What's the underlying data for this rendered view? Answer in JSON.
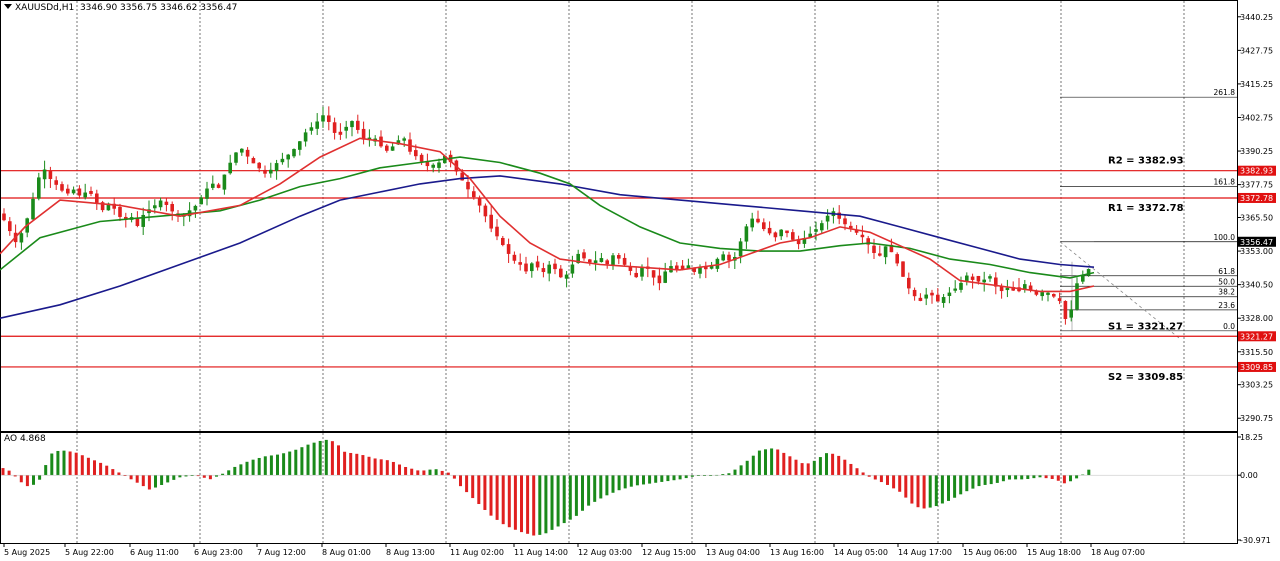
{
  "header": {
    "symbol_timeframe": "XAUUSDd,H1",
    "ohlc": "3346.90 3356.75 3346.62 3356.47"
  },
  "indicator": {
    "label": "AO 4.868"
  },
  "colors": {
    "bull": "#1a8a1a",
    "bear": "#e02020",
    "ma_fast": "#e03030",
    "ma_mid": "#1a8a1a",
    "ma_slow": "#1a1a8c",
    "level_line": "#e01010",
    "price_tag": "#000000"
  },
  "current_price": "3356.47",
  "chart_data": {
    "type": "candlestick",
    "symbol": "XAUUSDd",
    "timeframe": "H1",
    "ylim": [
      3290,
      3445
    ],
    "price_axis_ticks": [
      "3440.25",
      "3427.75",
      "3415.25",
      "3402.75",
      "3390.25",
      "3377.75",
      "3365.50",
      "3353.00",
      "3340.50",
      "3328.00",
      "3315.50",
      "3303.25",
      "3290.75"
    ],
    "time_labels": [
      "5 Aug 2025",
      "5 Aug 22:00",
      "6 Aug 11:00",
      "6 Aug 23:00",
      "7 Aug 12:00",
      "8 Aug 01:00",
      "8 Aug 13:00",
      "11 Aug 02:00",
      "11 Aug 14:00",
      "12 Aug 03:00",
      "12 Aug 15:00",
      "13 Aug 04:00",
      "13 Aug 16:00",
      "14 Aug 05:00",
      "14 Aug 17:00",
      "15 Aug 06:00",
      "15 Aug 18:00",
      "18 Aug 07:00"
    ],
    "close_path": [
      [
        0,
        3367
      ],
      [
        8,
        3362
      ],
      [
        15,
        3356
      ],
      [
        22,
        3360
      ],
      [
        28,
        3366
      ],
      [
        35,
        3375
      ],
      [
        42,
        3385
      ],
      [
        50,
        3380
      ],
      [
        58,
        3377
      ],
      [
        66,
        3374
      ],
      [
        74,
        3376
      ],
      [
        81,
        3373
      ],
      [
        88,
        3376
      ],
      [
        95,
        3372
      ],
      [
        102,
        3368
      ],
      [
        109,
        3371
      ],
      [
        116,
        3368
      ],
      [
        123,
        3364
      ],
      [
        131,
        3366
      ],
      [
        138,
        3362
      ],
      [
        145,
        3368
      ],
      [
        152,
        3369
      ],
      [
        160,
        3372
      ],
      [
        167,
        3370
      ],
      [
        174,
        3367
      ],
      [
        181,
        3365
      ],
      [
        189,
        3368
      ],
      [
        196,
        3370
      ],
      [
        203,
        3374
      ],
      [
        210,
        3378
      ],
      [
        218,
        3376
      ],
      [
        225,
        3382
      ],
      [
        233,
        3388
      ],
      [
        240,
        3392
      ],
      [
        248,
        3388
      ],
      [
        255,
        3385
      ],
      [
        262,
        3383
      ],
      [
        270,
        3382
      ],
      [
        277,
        3386
      ],
      [
        285,
        3388
      ],
      [
        292,
        3390
      ],
      [
        300,
        3394
      ],
      [
        307,
        3398
      ],
      [
        315,
        3400
      ],
      [
        322,
        3404
      ],
      [
        329,
        3401
      ],
      [
        336,
        3396
      ],
      [
        344,
        3398
      ],
      [
        351,
        3402
      ],
      [
        358,
        3398
      ],
      [
        366,
        3393
      ],
      [
        373,
        3396
      ],
      [
        381,
        3392
      ],
      [
        388,
        3390
      ],
      [
        395,
        3393
      ],
      [
        403,
        3396
      ],
      [
        410,
        3390
      ],
      [
        417,
        3388
      ],
      [
        425,
        3385
      ],
      [
        432,
        3384
      ],
      [
        439,
        3386
      ],
      [
        446,
        3389
      ],
      [
        454,
        3384
      ],
      [
        461,
        3380
      ],
      [
        468,
        3376
      ],
      [
        476,
        3372
      ],
      [
        483,
        3368
      ],
      [
        490,
        3362
      ],
      [
        498,
        3358
      ],
      [
        505,
        3354
      ],
      [
        512,
        3350
      ],
      [
        520,
        3348
      ],
      [
        527,
        3345
      ],
      [
        534,
        3350
      ],
      [
        541,
        3344
      ],
      [
        549,
        3348
      ],
      [
        556,
        3346
      ],
      [
        563,
        3342
      ],
      [
        571,
        3347
      ],
      [
        578,
        3352
      ],
      [
        585,
        3350
      ],
      [
        593,
        3348
      ],
      [
        600,
        3350
      ],
      [
        607,
        3348
      ],
      [
        614,
        3352
      ],
      [
        622,
        3349
      ],
      [
        629,
        3346
      ],
      [
        636,
        3344
      ],
      [
        644,
        3348
      ],
      [
        651,
        3345
      ],
      [
        658,
        3340
      ],
      [
        666,
        3346
      ],
      [
        673,
        3348
      ],
      [
        680,
        3346
      ],
      [
        688,
        3347
      ],
      [
        695,
        3345
      ],
      [
        702,
        3348
      ],
      [
        710,
        3346
      ],
      [
        717,
        3350
      ],
      [
        724,
        3352
      ],
      [
        732,
        3348
      ],
      [
        739,
        3355
      ],
      [
        746,
        3362
      ],
      [
        754,
        3366
      ],
      [
        761,
        3362
      ],
      [
        768,
        3360
      ],
      [
        776,
        3358
      ],
      [
        783,
        3362
      ],
      [
        790,
        3358
      ],
      [
        797,
        3356
      ],
      [
        805,
        3358
      ],
      [
        812,
        3360
      ],
      [
        819,
        3362
      ],
      [
        827,
        3366
      ],
      [
        834,
        3368
      ],
      [
        841,
        3364
      ],
      [
        849,
        3362
      ],
      [
        856,
        3360
      ],
      [
        863,
        3358
      ],
      [
        871,
        3354
      ],
      [
        878,
        3350
      ],
      [
        885,
        3355
      ],
      [
        893,
        3352
      ],
      [
        900,
        3346
      ],
      [
        907,
        3340
      ],
      [
        915,
        3336
      ],
      [
        922,
        3335
      ],
      [
        929,
        3338
      ],
      [
        937,
        3334
      ],
      [
        944,
        3336
      ],
      [
        951,
        3338
      ],
      [
        959,
        3340
      ],
      [
        966,
        3344
      ],
      [
        973,
        3343
      ],
      [
        981,
        3341
      ],
      [
        988,
        3344
      ],
      [
        995,
        3340
      ],
      [
        1002,
        3338
      ],
      [
        1010,
        3340
      ],
      [
        1017,
        3338
      ],
      [
        1024,
        3341
      ],
      [
        1032,
        3338
      ],
      [
        1039,
        3336
      ],
      [
        1046,
        3338
      ],
      [
        1054,
        3336
      ],
      [
        1061,
        3334
      ],
      [
        1068,
        3324
      ],
      [
        1075,
        3340
      ],
      [
        1083,
        3344
      ],
      [
        1090,
        3346.9
      ],
      [
        1094,
        3356.47
      ]
    ],
    "moving_averages": {
      "fast_red": [
        [
          0,
          3352
        ],
        [
          25,
          3362
        ],
        [
          60,
          3372
        ],
        [
          120,
          3370
        ],
        [
          180,
          3366
        ],
        [
          240,
          3370
        ],
        [
          280,
          3378
        ],
        [
          320,
          3388
        ],
        [
          360,
          3395
        ],
        [
          400,
          3393
        ],
        [
          440,
          3390
        ],
        [
          470,
          3380
        ],
        [
          500,
          3366
        ],
        [
          530,
          3356
        ],
        [
          560,
          3350
        ],
        [
          600,
          3348
        ],
        [
          640,
          3347
        ],
        [
          680,
          3346
        ],
        [
          720,
          3348
        ],
        [
          750,
          3352
        ],
        [
          780,
          3356
        ],
        [
          810,
          3358
        ],
        [
          840,
          3362
        ],
        [
          870,
          3360
        ],
        [
          900,
          3355
        ],
        [
          930,
          3350
        ],
        [
          960,
          3342
        ],
        [
          1000,
          3340
        ],
        [
          1040,
          3338
        ],
        [
          1070,
          3338
        ],
        [
          1094,
          3340
        ]
      ],
      "mid_green": [
        [
          0,
          3346
        ],
        [
          40,
          3358
        ],
        [
          100,
          3364
        ],
        [
          160,
          3366
        ],
        [
          220,
          3368
        ],
        [
          260,
          3372
        ],
        [
          300,
          3377
        ],
        [
          340,
          3380
        ],
        [
          380,
          3384
        ],
        [
          420,
          3386
        ],
        [
          460,
          3388
        ],
        [
          500,
          3386
        ],
        [
          540,
          3382
        ],
        [
          570,
          3378
        ],
        [
          600,
          3370
        ],
        [
          640,
          3362
        ],
        [
          680,
          3356
        ],
        [
          720,
          3354
        ],
        [
          760,
          3353
        ],
        [
          800,
          3353
        ],
        [
          840,
          3355
        ],
        [
          870,
          3356
        ],
        [
          910,
          3354
        ],
        [
          950,
          3350
        ],
        [
          990,
          3348
        ],
        [
          1030,
          3345
        ],
        [
          1070,
          3343
        ],
        [
          1094,
          3345
        ]
      ],
      "slow_blue": [
        [
          0,
          3328
        ],
        [
          60,
          3333
        ],
        [
          120,
          3340
        ],
        [
          180,
          3348
        ],
        [
          240,
          3356
        ],
        [
          300,
          3366
        ],
        [
          340,
          3372
        ],
        [
          380,
          3375
        ],
        [
          420,
          3378
        ],
        [
          460,
          3380
        ],
        [
          500,
          3381
        ],
        [
          560,
          3378
        ],
        [
          620,
          3374
        ],
        [
          680,
          3372
        ],
        [
          740,
          3370
        ],
        [
          800,
          3368
        ],
        [
          860,
          3366
        ],
        [
          900,
          3362
        ],
        [
          940,
          3358
        ],
        [
          980,
          3354
        ],
        [
          1020,
          3350
        ],
        [
          1060,
          3348
        ],
        [
          1094,
          3347
        ]
      ]
    },
    "horizontal_levels": [
      {
        "label": "R2 = 3382.93",
        "value": 3382.93,
        "tag": "3382.93"
      },
      {
        "label": "R1 = 3372.78",
        "value": 3372.78,
        "tag": "3372.78"
      },
      {
        "label": "S1 = 3321.27",
        "value": 3321.27,
        "tag": "3321.27"
      },
      {
        "label": "S2 = 3309.85",
        "value": 3309.85,
        "tag": "3309.85"
      }
    ],
    "fibonacci": {
      "start": 3323.3,
      "end": 3356.47,
      "levels": [
        {
          "ratio": "261.8",
          "price": 3410.3
        },
        {
          "ratio": "161.8",
          "price": 3377.0
        },
        {
          "ratio": "100.0",
          "price": 3356.47
        },
        {
          "ratio": "61.8",
          "price": 3343.8
        },
        {
          "ratio": "50.0",
          "price": 3339.9
        },
        {
          "ratio": "38.2",
          "price": 3336.0
        },
        {
          "ratio": "23.6",
          "price": 3331.1
        },
        {
          "ratio": "0.0",
          "price": 3323.3
        }
      ]
    },
    "ao": {
      "label": "AO 4.868",
      "ylim": [
        -30.971,
        18.25
      ],
      "axis_ticks": [
        "18.25",
        "0.00",
        "-30.971"
      ],
      "path": [
        [
          0,
          4
        ],
        [
          10,
          2
        ],
        [
          20,
          -3
        ],
        [
          30,
          -6
        ],
        [
          40,
          -2
        ],
        [
          50,
          10
        ],
        [
          60,
          12
        ],
        [
          75,
          11
        ],
        [
          90,
          8
        ],
        [
          105,
          5
        ],
        [
          120,
          1
        ],
        [
          135,
          -3
        ],
        [
          150,
          -7
        ],
        [
          165,
          -4
        ],
        [
          180,
          -1
        ],
        [
          195,
          0
        ],
        [
          210,
          -2
        ],
        [
          220,
          0
        ],
        [
          235,
          4
        ],
        [
          250,
          7
        ],
        [
          265,
          9
        ],
        [
          280,
          10
        ],
        [
          295,
          12
        ],
        [
          310,
          15
        ],
        [
          325,
          17
        ],
        [
          335,
          16
        ],
        [
          345,
          11
        ],
        [
          360,
          10
        ],
        [
          375,
          8
        ],
        [
          390,
          7
        ],
        [
          405,
          4
        ],
        [
          420,
          2
        ],
        [
          435,
          3
        ],
        [
          450,
          1
        ],
        [
          460,
          -5
        ],
        [
          475,
          -12
        ],
        [
          490,
          -19
        ],
        [
          505,
          -24
        ],
        [
          520,
          -27
        ],
        [
          535,
          -29
        ],
        [
          545,
          -28
        ],
        [
          560,
          -24
        ],
        [
          575,
          -20
        ],
        [
          590,
          -14
        ],
        [
          605,
          -10
        ],
        [
          620,
          -7
        ],
        [
          635,
          -5
        ],
        [
          650,
          -4
        ],
        [
          665,
          -3
        ],
        [
          680,
          -2
        ],
        [
          690,
          -1
        ],
        [
          700,
          0
        ],
        [
          715,
          0
        ],
        [
          730,
          1
        ],
        [
          745,
          6
        ],
        [
          760,
          12
        ],
        [
          775,
          13
        ],
        [
          790,
          9
        ],
        [
          805,
          5
        ],
        [
          815,
          7
        ],
        [
          828,
          11
        ],
        [
          840,
          9
        ],
        [
          855,
          4
        ],
        [
          870,
          -1
        ],
        [
          885,
          -4
        ],
        [
          900,
          -8
        ],
        [
          915,
          -15
        ],
        [
          925,
          -16
        ],
        [
          935,
          -15
        ],
        [
          950,
          -12
        ],
        [
          965,
          -8
        ],
        [
          980,
          -5
        ],
        [
          995,
          -4
        ],
        [
          1010,
          -2
        ],
        [
          1025,
          -2
        ],
        [
          1040,
          -1
        ],
        [
          1055,
          -2
        ],
        [
          1065,
          -4
        ],
        [
          1075,
          -2
        ],
        [
          1085,
          1
        ],
        [
          1094,
          4.868
        ]
      ]
    }
  }
}
